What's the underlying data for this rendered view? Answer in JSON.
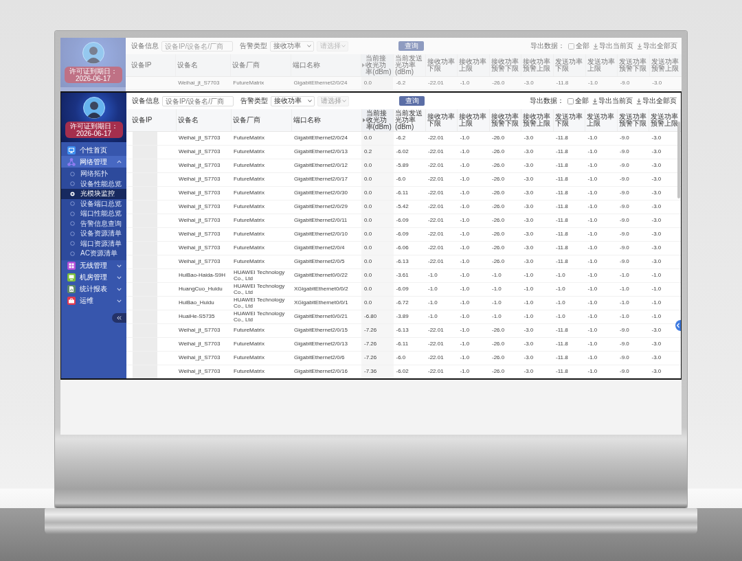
{
  "ghost_copy": {
    "sidebar": {
      "license": "许可证到期日：2026-06-17"
    },
    "filter_bar": {
      "device_label": "设备信息",
      "device_field": {
        "placeholder": "设备IP/设备名/厂商"
      },
      "alarm_label": "告警类型",
      "alarm_select": {
        "value": "接收功率"
      },
      "sub_select": {
        "placeholder": "请选择",
        "disabled": true
      },
      "query_button": "查询",
      "export_label": "导出数据：",
      "export_option": {
        "label": "全部",
        "checked": false
      },
      "export_links": [
        "导出当前页",
        "导出全部页"
      ]
    },
    "table": {
      "columns": [
        {
          "label": "设备IP",
          "sorted": false
        },
        {
          "label": "设备名",
          "sorted": false
        },
        {
          "label": "设备厂商",
          "sorted": false
        },
        {
          "label": "端口名称",
          "sorted": false
        },
        {
          "label": "当前接收光功率(dBm)",
          "sorted": true
        },
        {
          "label": "当前发送光功率(dBm)",
          "sorted": false
        },
        {
          "label": "接收功率下限",
          "sorted": false
        },
        {
          "label": "接收功率上限",
          "sorted": false
        },
        {
          "label": "接收功率预警下限",
          "sorted": false
        },
        {
          "label": "接收功率预警上限",
          "sorted": false
        },
        {
          "label": "发送功率下限",
          "sorted": false
        },
        {
          "label": "发送功率上限",
          "sorted": false
        },
        {
          "label": "发送功率预警下限",
          "sorted": false
        },
        {
          "label": "发送功率预警上限",
          "sorted": false
        }
      ],
      "rows": [
        {
          "cells": [
            "",
            "Weihai_jt_S7703",
            "FutureMatrix",
            "GigabitEthernet2/0/24",
            "0.0",
            "-6.2",
            "-22.01",
            "-1.0",
            "-26.0",
            "-3.0",
            "-11.8",
            "-1.0",
            "-9.0",
            "-3.0"
          ]
        }
      ]
    }
  },
  "page": {
    "sidebar": {
      "license": "许可证到期日：2026-06-17",
      "menu": [
        {
          "label": "个性首页",
          "color": "#3d8ef0",
          "selected": false
        },
        {
          "label": "网络管理",
          "color": "#8f7cf2",
          "selected": false,
          "expanded": true,
          "children": [
            {
              "label": "网络拓扑",
              "selected": false
            },
            {
              "label": "设备性能总览",
              "selected": false
            },
            {
              "label": "光模块监控",
              "selected": true
            },
            {
              "label": "设备端口总览",
              "selected": false
            },
            {
              "label": "端口性能总览",
              "selected": false
            },
            {
              "label": "告警信息查询",
              "selected": false
            },
            {
              "label": "设备资源清单",
              "selected": false
            },
            {
              "label": "端口资源清单",
              "selected": false
            },
            {
              "label": "AC资源清单",
              "selected": false
            }
          ]
        },
        {
          "label": "无线管理",
          "color": "#b44fd8",
          "selected": false,
          "expanded": false
        },
        {
          "label": "机房管理",
          "color": "#7cbf3a",
          "selected": false,
          "expanded": false
        },
        {
          "label": "统计报表",
          "color": "#5f8a6a",
          "selected": false,
          "expanded": false
        },
        {
          "label": "运维",
          "color": "#e2384f",
          "selected": false,
          "expanded": false
        }
      ]
    },
    "filter_bar": {
      "device_label": "设备信息",
      "device_field": {
        "placeholder": "设备IP/设备名/厂商"
      },
      "alarm_label": "告警类型",
      "alarm_select": {
        "value": "接收功率"
      },
      "sub_select": {
        "placeholder": "请选择",
        "disabled": true
      },
      "query_button": "查询",
      "export_label": "导出数据：",
      "export_option": {
        "label": "全部",
        "checked": false
      },
      "export_links": [
        "导出当前页",
        "导出全部页"
      ]
    },
    "table": {
      "columns": [
        {
          "label": "设备IP",
          "sorted": false
        },
        {
          "label": "设备名",
          "sorted": false
        },
        {
          "label": "设备厂商",
          "sorted": false
        },
        {
          "label": "端口名称",
          "sorted": false
        },
        {
          "label": "当前接收光功率(dBm)",
          "sorted": true
        },
        {
          "label": "当前发送光功率(dBm)",
          "sorted": false
        },
        {
          "label": "接收功率下限",
          "sorted": false
        },
        {
          "label": "接收功率上限",
          "sorted": false
        },
        {
          "label": "接收功率预警下限",
          "sorted": false
        },
        {
          "label": "接收功率预警上限",
          "sorted": false
        },
        {
          "label": "发送功率下限",
          "sorted": false
        },
        {
          "label": "发送功率上限",
          "sorted": false
        },
        {
          "label": "发送功率预警下限",
          "sorted": false
        },
        {
          "label": "发送功率预警上限",
          "sorted": false
        }
      ],
      "rows": [
        {
          "ip_redacted": true,
          "cells": [
            "",
            "Weihai_jt_S7703",
            "FutureMatrix",
            "GigabitEthernet2/0/24",
            "0.0",
            "-6.2",
            "-22.01",
            "-1.0",
            "-26.0",
            "-3.0",
            "-11.8",
            "-1.0",
            "-9.0",
            "-3.0"
          ]
        },
        {
          "ip_redacted": true,
          "cells": [
            "",
            "Weihai_jt_S7703",
            "FutureMatrix",
            "GigabitEthernet2/0/13",
            "0.2",
            "-6.02",
            "-22.01",
            "-1.0",
            "-26.0",
            "-3.0",
            "-11.8",
            "-1.0",
            "-9.0",
            "-3.0"
          ]
        },
        {
          "ip_redacted": true,
          "cells": [
            "",
            "Weihai_jt_S7703",
            "FutureMatrix",
            "GigabitEthernet2/0/12",
            "0.0",
            "-5.89",
            "-22.01",
            "-1.0",
            "-26.0",
            "-3.0",
            "-11.8",
            "-1.0",
            "-9.0",
            "-3.0"
          ]
        },
        {
          "ip_redacted": true,
          "cells": [
            "",
            "Weihai_jt_S7703",
            "FutureMatrix",
            "GigabitEthernet2/0/17",
            "0.0",
            "-6.0",
            "-22.01",
            "-1.0",
            "-26.0",
            "-3.0",
            "-11.8",
            "-1.0",
            "-9.0",
            "-3.0"
          ]
        },
        {
          "ip_redacted": true,
          "cells": [
            "",
            "Weihai_jt_S7703",
            "FutureMatrix",
            "GigabitEthernet2/0/30",
            "0.0",
            "-6.11",
            "-22.01",
            "-1.0",
            "-26.0",
            "-3.0",
            "-11.8",
            "-1.0",
            "-9.0",
            "-3.0"
          ]
        },
        {
          "ip_redacted": true,
          "cells": [
            "",
            "Weihai_jt_S7703",
            "FutureMatrix",
            "GigabitEthernet2/0/29",
            "0.0",
            "-5.42",
            "-22.01",
            "-1.0",
            "-26.0",
            "-3.0",
            "-11.8",
            "-1.0",
            "-9.0",
            "-3.0"
          ]
        },
        {
          "ip_redacted": true,
          "cells": [
            "",
            "Weihai_jt_S7703",
            "FutureMatrix",
            "GigabitEthernet2/0/11",
            "0.0",
            "-6.09",
            "-22.01",
            "-1.0",
            "-26.0",
            "-3.0",
            "-11.8",
            "-1.0",
            "-9.0",
            "-3.0"
          ]
        },
        {
          "ip_redacted": true,
          "cells": [
            "",
            "Weihai_jt_S7703",
            "FutureMatrix",
            "GigabitEthernet2/0/10",
            "0.0",
            "-6.09",
            "-22.01",
            "-1.0",
            "-26.0",
            "-3.0",
            "-11.8",
            "-1.0",
            "-9.0",
            "-3.0"
          ]
        },
        {
          "ip_redacted": true,
          "cells": [
            "",
            "Weihai_jt_S7703",
            "FutureMatrix",
            "GigabitEthernet2/0/4",
            "0.0",
            "-6.06",
            "-22.01",
            "-1.0",
            "-26.0",
            "-3.0",
            "-11.8",
            "-1.0",
            "-9.0",
            "-3.0"
          ]
        },
        {
          "ip_redacted": true,
          "cells": [
            "",
            "Weihai_jt_S7703",
            "FutureMatrix",
            "GigabitEthernet2/0/5",
            "0.0",
            "-6.13",
            "-22.01",
            "-1.0",
            "-26.0",
            "-3.0",
            "-11.8",
            "-1.0",
            "-9.0",
            "-3.0"
          ]
        },
        {
          "ip_redacted": true,
          "cells": [
            "",
            "HuiBao-Haida-S9H",
            "HUAWEI Technology Co., Ltd",
            "GigabitEthernet0/0/22",
            "0.0",
            "-3.61",
            "-1.0",
            "-1.0",
            "-1.0",
            "-1.0",
            "-1.0",
            "-1.0",
            "-1.0",
            "-1.0"
          ]
        },
        {
          "ip_redacted": true,
          "cells": [
            "",
            "HuangCuo_Huidu",
            "HUAWEI Technology Co., Ltd",
            "XGigabitEthernet0/0/2",
            "0.0",
            "-6.09",
            "-1.0",
            "-1.0",
            "-1.0",
            "-1.0",
            "-1.0",
            "-1.0",
            "-1.0",
            "-1.0"
          ]
        },
        {
          "ip_redacted": true,
          "cells": [
            "",
            "HuiBao_Huidu",
            "HUAWEI Technology Co., Ltd",
            "XGigabitEthernet0/0/1",
            "0.0",
            "-6.72",
            "-1.0",
            "-1.0",
            "-1.0",
            "-1.0",
            "-1.0",
            "-1.0",
            "-1.0",
            "-1.0"
          ]
        },
        {
          "ip_redacted": true,
          "cells": [
            "",
            "HuaiHe-S5735",
            "HUAWEI Technology Co., Ltd",
            "GigabitEthernet0/0/21",
            "-6.80",
            "-3.89",
            "-1.0",
            "-1.0",
            "-1.0",
            "-1.0",
            "-1.0",
            "-1.0",
            "-1.0",
            "-1.0"
          ]
        },
        {
          "ip_redacted": true,
          "cells": [
            "",
            "Weihai_jt_S7703",
            "FutureMatrix",
            "GigabitEthernet2/0/15",
            "-7.26",
            "-6.13",
            "-22.01",
            "-1.0",
            "-26.0",
            "-3.0",
            "-11.8",
            "-1.0",
            "-9.0",
            "-3.0"
          ]
        },
        {
          "ip_redacted": true,
          "cells": [
            "",
            "Weihai_jt_S7703",
            "FutureMatrix",
            "GigabitEthernet2/0/13",
            "-7.26",
            "-6.11",
            "-22.01",
            "-1.0",
            "-26.0",
            "-3.0",
            "-11.8",
            "-1.0",
            "-9.0",
            "-3.0"
          ]
        },
        {
          "ip_redacted": true,
          "cells": [
            "",
            "Weihai_jt_S7703",
            "FutureMatrix",
            "GigabitEthernet2/0/6",
            "-7.26",
            "-6.0",
            "-22.01",
            "-1.0",
            "-26.0",
            "-3.0",
            "-11.8",
            "-1.0",
            "-9.0",
            "-3.0"
          ]
        },
        {
          "ip_redacted": true,
          "cells": [
            "",
            "Weihai_jt_S7703",
            "FutureMatrix",
            "GigabitEthernet2/0/16",
            "-7.36",
            "-6.02",
            "-22.01",
            "-1.0",
            "-26.0",
            "-3.0",
            "-11.8",
            "-1.0",
            "-9.0",
            "-3.0"
          ]
        }
      ]
    }
  }
}
